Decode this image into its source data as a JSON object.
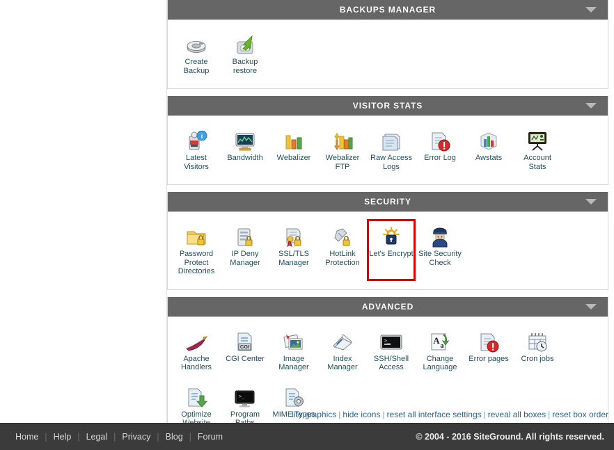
{
  "theme": {
    "header_bg": "#666666",
    "header_text": "#ffffff",
    "label_color": "#1f4e5f",
    "link_color": "#2a6496",
    "highlight_border": "#e10000",
    "footer_bg": "#3b3b3b"
  },
  "sections": [
    {
      "title": "BACKUPS MANAGER",
      "toggle_icon": "chevron-down-icon",
      "items": [
        {
          "label": "Create Backup",
          "icon": "disk-drive-icon",
          "highlighted": false
        },
        {
          "label": "Backup restore",
          "icon": "restore-arrow-icon",
          "highlighted": false
        }
      ]
    },
    {
      "title": "VISITOR STATS",
      "toggle_icon": "chevron-down-icon",
      "items": [
        {
          "label": "Latest Visitors",
          "icon": "visitor-info-icon",
          "highlighted": false
        },
        {
          "label": "Bandwidth",
          "icon": "bandwidth-monitor-icon",
          "highlighted": false
        },
        {
          "label": "Webalizer",
          "icon": "bar-chart-icon",
          "highlighted": false
        },
        {
          "label": "Webalizer FTP",
          "icon": "bar-chart-transfer-icon",
          "highlighted": false
        },
        {
          "label": "Raw Access Logs",
          "icon": "document-stack-icon",
          "highlighted": false
        },
        {
          "label": "Error Log",
          "icon": "document-error-icon",
          "highlighted": false
        },
        {
          "label": "Awstats",
          "icon": "cube-chart-icon",
          "highlighted": false
        },
        {
          "label": "Account Stats",
          "icon": "presentation-board-icon",
          "highlighted": false
        }
      ]
    },
    {
      "title": "SECURITY",
      "toggle_icon": "chevron-down-icon",
      "items": [
        {
          "label": "Password Protect Directories",
          "icon": "folder-lock-icon",
          "highlighted": false
        },
        {
          "label": "IP Deny Manager",
          "icon": "server-lock-icon",
          "highlighted": false
        },
        {
          "label": "SSL/TLS Manager",
          "icon": "certificate-lock-icon",
          "highlighted": false
        },
        {
          "label": "HotLink Protection",
          "icon": "link-lock-icon",
          "highlighted": false
        },
        {
          "label": "Let's Encrypt",
          "icon": "padlock-sun-icon",
          "highlighted": true
        },
        {
          "label": "Site Security Check",
          "icon": "police-officer-icon",
          "highlighted": false
        }
      ]
    },
    {
      "title": "ADVANCED",
      "toggle_icon": "chevron-down-icon",
      "items": [
        {
          "label": "Apache Handlers",
          "icon": "feather-icon",
          "highlighted": false
        },
        {
          "label": "CGI Center",
          "icon": "cgi-document-icon",
          "highlighted": false
        },
        {
          "label": "Image Manager",
          "icon": "image-stack-icon",
          "highlighted": false
        },
        {
          "label": "Index Manager",
          "icon": "open-book-icon",
          "highlighted": false
        },
        {
          "label": "SSH/Shell Access",
          "icon": "terminal-icon",
          "highlighted": false
        },
        {
          "label": "Change Language",
          "icon": "language-letters-icon",
          "highlighted": false
        },
        {
          "label": "Error pages",
          "icon": "document-error-icon",
          "highlighted": false
        },
        {
          "label": "Cron jobs",
          "icon": "calendar-clock-icon",
          "highlighted": false
        },
        {
          "label": "Optimize Website",
          "icon": "document-download-icon",
          "highlighted": false
        },
        {
          "label": "Program Paths",
          "icon": "monitor-terminal-icon",
          "highlighted": false
        },
        {
          "label": "MIME Types",
          "icon": "document-gear-icon",
          "highlighted": false
        }
      ]
    }
  ],
  "interface_links": [
    "lite graphics",
    "hide icons",
    "reset all interface settings",
    "reveal all boxes",
    "reset box order"
  ],
  "footer": {
    "nav": [
      "Home",
      "Help",
      "Legal",
      "Privacy",
      "Blog",
      "Forum"
    ],
    "copyright": "© 2004 - 2016 SiteGround. All rights reserved."
  }
}
